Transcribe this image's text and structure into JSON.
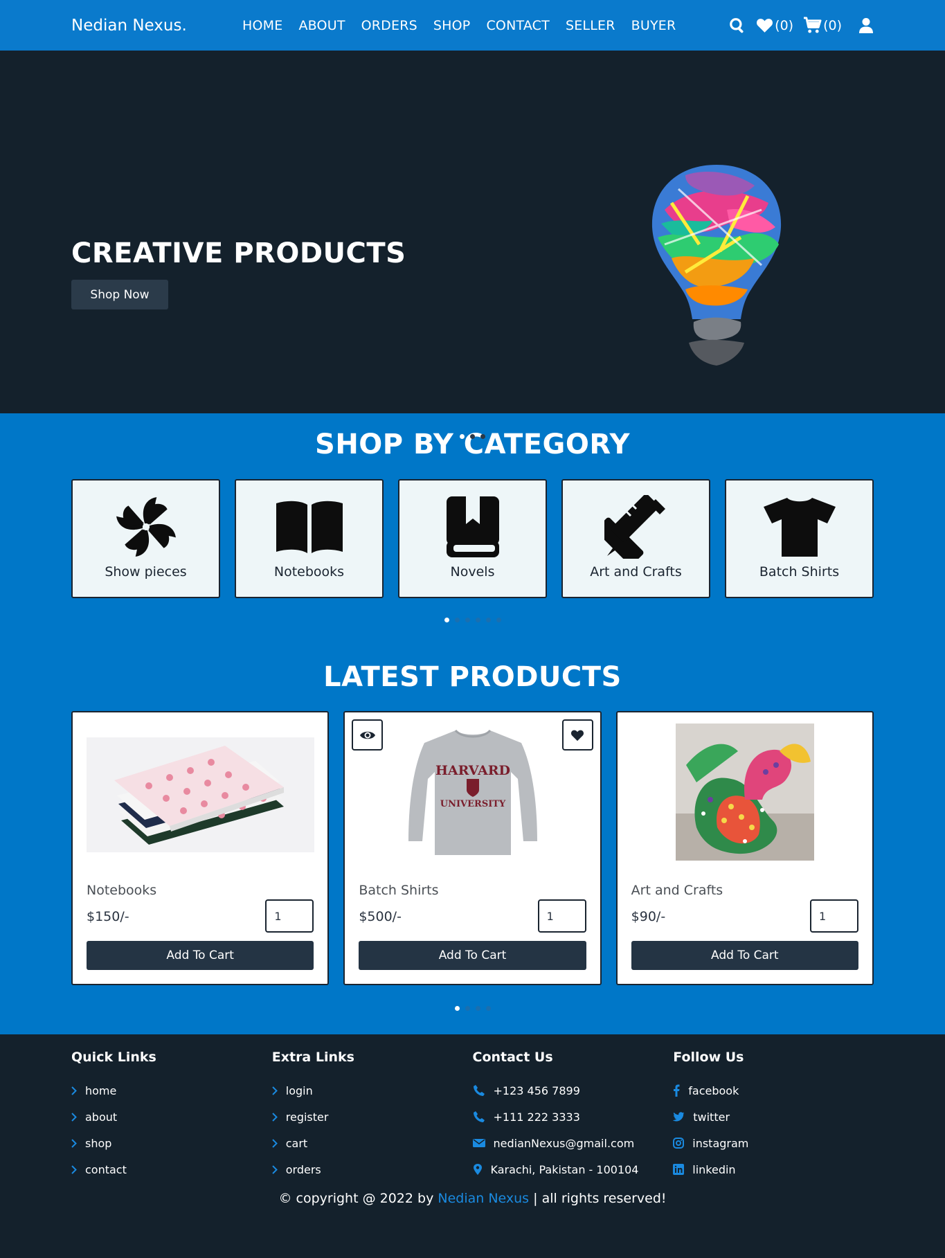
{
  "header": {
    "logo": "Nedian Nexus.",
    "nav": [
      "HOME",
      "ABOUT",
      "ORDERS",
      "SHOP",
      "CONTACT",
      "SELLER",
      "BUYER"
    ],
    "wishlist_count": "(0)",
    "cart_count": "(0)",
    "icons": [
      "search-icon",
      "heart-icon",
      "cart-icon",
      "user-icon"
    ]
  },
  "hero": {
    "title": "CREATIVE PRODUCTS",
    "button": "Shop Now",
    "slides": 3,
    "active_slide": 1
  },
  "category": {
    "title": "SHOP BY CATEGORY",
    "items": [
      {
        "label": "Show pieces",
        "icon": "pinwheel-icon"
      },
      {
        "label": "Notebooks",
        "icon": "open-book-icon"
      },
      {
        "label": "Novels",
        "icon": "book-icon"
      },
      {
        "label": "Art and Crafts",
        "icon": "pencil-ruler-icon"
      },
      {
        "label": "Batch Shirts",
        "icon": "tshirt-icon"
      }
    ],
    "pages": 6,
    "active_page": 1
  },
  "latest": {
    "title": "LATEST PRODUCTS",
    "products": [
      {
        "name": "Notebooks",
        "price": "$150/-",
        "qty": "1",
        "button": "Add To Cart"
      },
      {
        "name": "Batch Shirts",
        "price": "$500/-",
        "qty": "1",
        "button": "Add To Cart",
        "shirt_text_1": "HARVARD",
        "shirt_text_2": "UNIVERSITY"
      },
      {
        "name": "Art and Crafts",
        "price": "$90/-",
        "qty": "1",
        "button": "Add To Cart"
      }
    ],
    "pages": 4,
    "active_page": 1
  },
  "footer": {
    "quick_links": {
      "title": "Quick Links",
      "items": [
        "home",
        "about",
        "shop",
        "contact"
      ]
    },
    "extra_links": {
      "title": "Extra Links",
      "items": [
        "login",
        "register",
        "cart",
        "orders"
      ]
    },
    "contact": {
      "title": "Contact Us",
      "items": [
        "+123 456 7899",
        "+111 222 3333",
        "nedianNexus@gmail.com",
        "Karachi, Pakistan - 100104"
      ]
    },
    "follow": {
      "title": "Follow Us",
      "items": [
        "facebook",
        "twitter",
        "instagram",
        "linkedin"
      ]
    },
    "copyright_prefix": "© copyright @ 2022 by ",
    "copyright_brand": "Nedian Nexus",
    "copyright_suffix": " | all rights reserved!"
  },
  "colors": {
    "header_bg": "#0a7acc",
    "hero_bg": "#14212c",
    "section_bg": "#0077c8",
    "button_dark": "#243444",
    "footer_accent": "#1a8ae0"
  }
}
